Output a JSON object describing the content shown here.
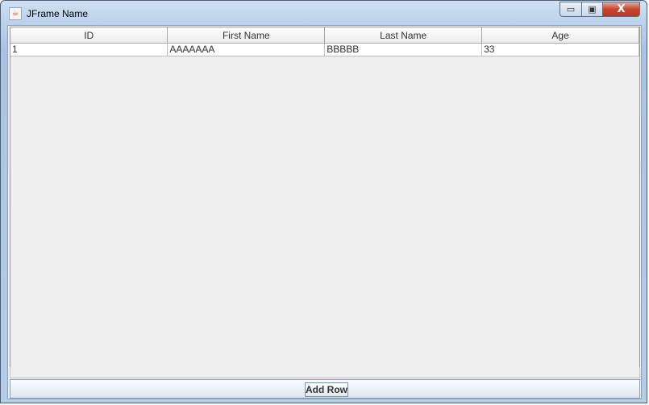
{
  "window": {
    "title": "JFrame Name",
    "controls": {
      "minimize_glyph": "▭",
      "maximize_glyph": "▣",
      "close_glyph": "X"
    }
  },
  "table": {
    "columns": [
      "ID",
      "First Name",
      "Last Name",
      "Age"
    ],
    "rows": [
      [
        "1",
        "AAAAAAA",
        "BBBBB",
        "33"
      ]
    ]
  },
  "footer": {
    "add_row_label": "Add Row"
  },
  "icons": {
    "app": "java-icon"
  }
}
